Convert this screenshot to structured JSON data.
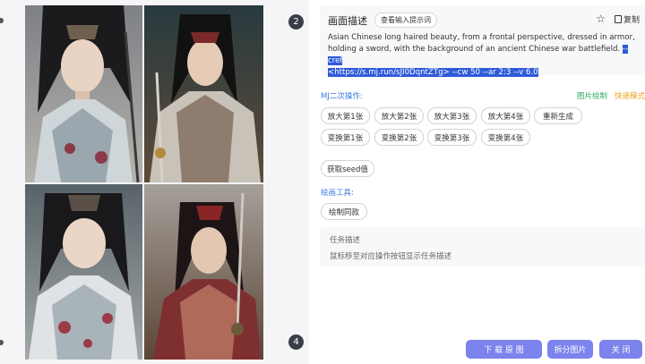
{
  "description": {
    "title": "画面描述",
    "view_prompt_label": "查看输入提示词",
    "copy_label": "复制",
    "text_plain": "Asian Chinese long haired beauty, from a frontal perspective, dressed in armor, holding a sword, with the background of an ancient Chinese war battlefield. ",
    "text_highlight_1": "--cref",
    "text_highlight_2": "<https://s.mj.run/sJI0DqntZTg> --cw 50 --ar 2:3 --v 6.0"
  },
  "image_grid": {
    "badge_top": "2",
    "badge_bottom": "4"
  },
  "mj_ops": {
    "label": "MJ二次操作:",
    "link_partial_redraw": "图片绘制",
    "link_fast_mode": "快速模式",
    "buttons": [
      "放大第1张",
      "放大第2张",
      "放大第3张",
      "放大第4张",
      "重新生成",
      "变换第1张",
      "变换第2张",
      "变换第3张",
      "变换第4张"
    ],
    "seed_button": "获取seed值"
  },
  "draw_tools": {
    "label": "绘画工具:",
    "same_style_button": "绘制同款"
  },
  "task": {
    "title": "任务描述",
    "hint": "鼠标移至对应操作按钮显示任务描述"
  },
  "footer": {
    "download": "下 载 原 图",
    "split": "拆分图片",
    "close": "关 闭"
  },
  "colors": {
    "accent": "#7c83ec",
    "link_blue": "#3d7be0",
    "highlight": "#2f5bd8",
    "green": "#2eab66",
    "orange": "#f0a020"
  }
}
